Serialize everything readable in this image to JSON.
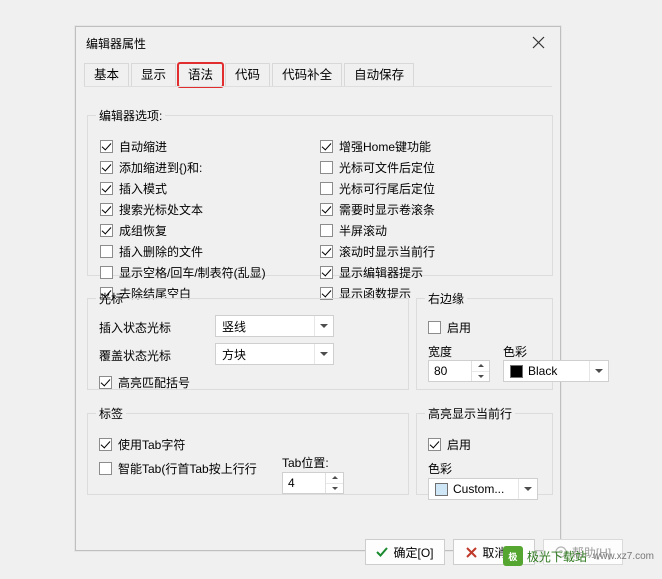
{
  "window": {
    "title": "编辑器属性",
    "close_icon": "close-icon"
  },
  "tabs": [
    {
      "label": "基本",
      "selected": false,
      "highlighted": false
    },
    {
      "label": "显示",
      "selected": false,
      "highlighted": false
    },
    {
      "label": "语法",
      "selected": true,
      "highlighted": true
    },
    {
      "label": "代码",
      "selected": false,
      "highlighted": false
    },
    {
      "label": "代码补全",
      "selected": false,
      "highlighted": false
    },
    {
      "label": "自动保存",
      "selected": false,
      "highlighted": false
    }
  ],
  "groups": {
    "editor_options": {
      "legend": "编辑器选项:",
      "left": [
        {
          "label": "自动缩进",
          "checked": true
        },
        {
          "label": "添加缩进到{)和:",
          "checked": true
        },
        {
          "label": "插入模式",
          "checked": true
        },
        {
          "label": "搜索光标处文本",
          "checked": true
        },
        {
          "label": "成组恢复",
          "checked": true
        },
        {
          "label": "插入删除的文件",
          "checked": false
        },
        {
          "label": "显示空格/回车/制表符(乱显)",
          "checked": false
        },
        {
          "label": "去除结尾空白",
          "checked": true
        }
      ],
      "right": [
        {
          "label": "增强Home键功能",
          "checked": true
        },
        {
          "label": "光标可文件后定位",
          "checked": false
        },
        {
          "label": "光标可行尾后定位",
          "checked": false
        },
        {
          "label": "需要时显示卷滚条",
          "checked": true
        },
        {
          "label": "半屏滚动",
          "checked": false
        },
        {
          "label": "滚动时显示当前行",
          "checked": true
        },
        {
          "label": "显示编辑器提示",
          "checked": true
        },
        {
          "label": "显示函数提示",
          "checked": true
        }
      ]
    },
    "cursor": {
      "legend": "光标",
      "insert_label": "插入状态光标",
      "insert_value": "竖线",
      "overwrite_label": "覆盖状态光标",
      "overwrite_value": "方块",
      "highlight_bracket": {
        "label": "高亮匹配括号",
        "checked": true
      }
    },
    "right_edge": {
      "legend": "右边缘",
      "enable": {
        "label": "启用",
        "checked": false
      },
      "width_label": "宽度",
      "width_value": "80",
      "color_label": "色彩",
      "color_value": "Black",
      "color_hex": "#000000"
    },
    "tab_group": {
      "legend": "标签",
      "use_tab": {
        "label": "使用Tab字符",
        "checked": true
      },
      "smart_tab": {
        "label": "智能Tab(行首Tab按上行行",
        "checked": false
      },
      "tab_pos_label": "Tab位置:",
      "tab_pos_value": "4"
    },
    "highlight_line": {
      "legend": "高亮显示当前行",
      "enable": {
        "label": "启用",
        "checked": true
      },
      "color_label": "色彩",
      "color_value": "Custom...",
      "color_hex": "#cfe6f7"
    }
  },
  "buttons": {
    "ok": {
      "label": "确定[O]",
      "icon": "check-icon"
    },
    "cancel": {
      "label": "取消[C]",
      "icon": "cross-icon"
    },
    "help": {
      "label": "帮助[H]",
      "icon": "question-icon",
      "disabled": true
    }
  },
  "watermark": {
    "logo_text": "极",
    "name": "极光下载站",
    "site": "www.xz7.com"
  }
}
